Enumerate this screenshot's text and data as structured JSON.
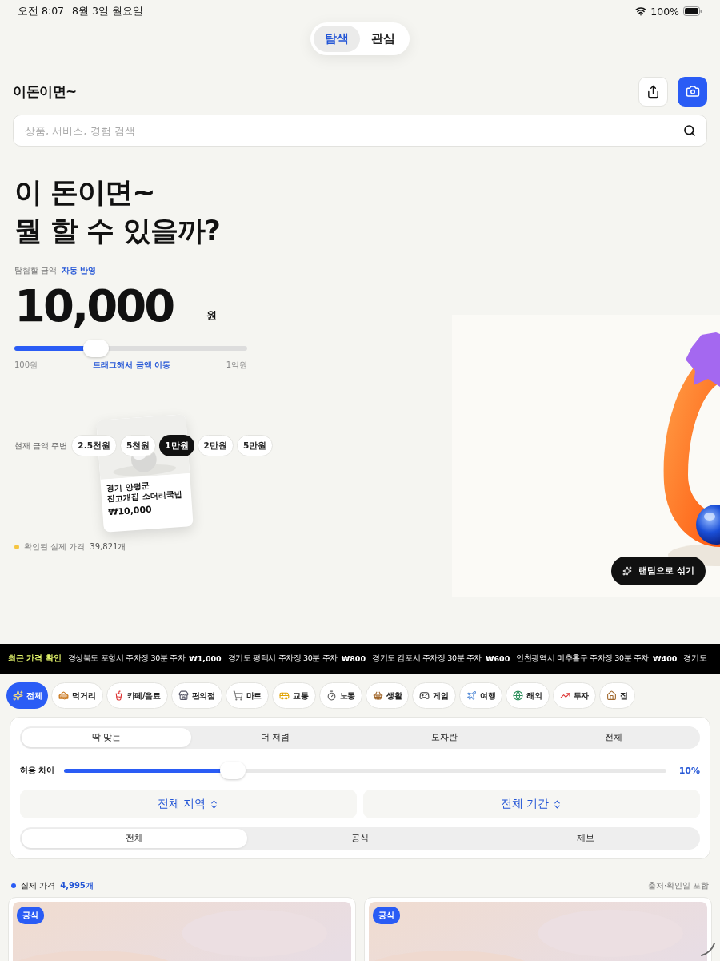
{
  "status_bar": {
    "time": "오전 8:07",
    "date": "8월 3일 월요일",
    "battery": "100%"
  },
  "mode_tabs": [
    {
      "label": "탐색",
      "selected": true
    },
    {
      "label": "관심",
      "selected": false
    }
  ],
  "header": {
    "title": "이돈이면~"
  },
  "search": {
    "placeholder": "상품, 서비스, 경험 검색"
  },
  "hero": {
    "headline": [
      "이 돈이면~",
      "뭘 할 수 있을까?"
    ],
    "amount_label": "탐험할 금액",
    "auto_label": "자동 반영",
    "amount": "10,000",
    "unit": "원",
    "slider": {
      "level": 0.35,
      "min_label": "100원",
      "hint": "드래그해서 금액 이동",
      "max_label": "1억원"
    },
    "nearby_label": "현재 금액 주변",
    "nearby": [
      {
        "label": "2.5천원",
        "selected": false
      },
      {
        "label": "5천원",
        "selected": false
      },
      {
        "label": "1만원",
        "selected": true
      },
      {
        "label": "2만원",
        "selected": false
      },
      {
        "label": "5만원",
        "selected": false
      }
    ],
    "preview_card": {
      "kind": "picture",
      "region": "경기 양평군",
      "name": "진고개집 소머리국밥",
      "price": "₩10,000"
    },
    "verified_label": "확인된 실제 가격",
    "verified_count": "39,821개",
    "shuffle_button": "랜덤으로 섞기"
  },
  "ticker": {
    "label": "최근 가격 확인",
    "items": [
      {
        "text": "경상북도 포항시 주차장 30분 주차",
        "price": "₩1,000"
      },
      {
        "text": "경기도 평택시 주차장 30분 주차",
        "price": "₩800"
      },
      {
        "text": "경기도 김포시 주차장 30분 주차",
        "price": "₩600"
      },
      {
        "text": "인천광역시 미추홀구 주차장 30분 주차",
        "price": "₩400"
      },
      {
        "text": "경기도"
      }
    ]
  },
  "categories": [
    {
      "label": "전체",
      "selected": true
    },
    {
      "label": "먹거리",
      "selected": false
    },
    {
      "label": "카페/음료",
      "selected": false
    },
    {
      "label": "편의점",
      "selected": false
    },
    {
      "label": "마트",
      "selected": false
    },
    {
      "label": "교통",
      "selected": false
    },
    {
      "label": "노동",
      "selected": false
    },
    {
      "label": "생활",
      "selected": false
    },
    {
      "label": "게임",
      "selected": false
    },
    {
      "label": "여행",
      "selected": false
    },
    {
      "label": "해외",
      "selected": false
    },
    {
      "label": "투자",
      "selected": false
    },
    {
      "label": "집",
      "selected": false
    }
  ],
  "filters": {
    "match_tabs": [
      {
        "label": "딱 맞는",
        "selected": true
      },
      {
        "label": "더 저렴",
        "selected": false
      },
      {
        "label": "모자란",
        "selected": false
      },
      {
        "label": "전체",
        "selected": false
      }
    ],
    "tolerance": {
      "label": "허용 차이",
      "level": 0.28,
      "value": "10%"
    },
    "region": "전체 지역",
    "period": "전체 기간",
    "source_tabs": [
      {
        "label": "전체",
        "selected": true
      },
      {
        "label": "공식",
        "selected": false
      },
      {
        "label": "제보",
        "selected": false
      }
    ]
  },
  "results": {
    "label": "실제 가격",
    "count": "4,995개",
    "note": "출처·확인일 포함",
    "cards": [
      {
        "badge": "공식",
        "kind": "picture"
      },
      {
        "badge": "공식",
        "kind": "picture"
      }
    ]
  }
}
